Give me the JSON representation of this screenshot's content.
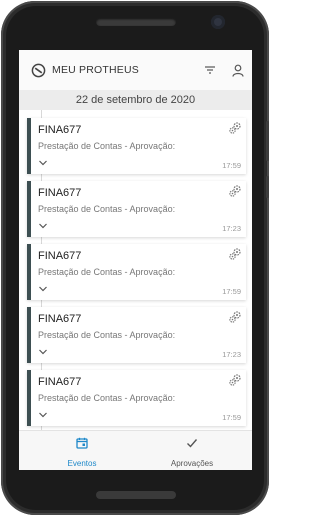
{
  "app": {
    "title": "MEU PROTHEUS"
  },
  "date_header": "22 de setembro de 2020",
  "events": [
    {
      "title": "FINA677",
      "subtitle": "Prestação de Contas - Aprovação:",
      "time": "17:59"
    },
    {
      "title": "FINA677",
      "subtitle": "Prestação de Contas - Aprovação:",
      "time": "17:23"
    },
    {
      "title": "FINA677",
      "subtitle": "Prestação de Contas - Aprovação:",
      "time": "17:59"
    },
    {
      "title": "FINA677",
      "subtitle": "Prestação de Contas - Aprovação:",
      "time": "17:23"
    },
    {
      "title": "FINA677",
      "subtitle": "Prestação de Contas - Aprovação:",
      "time": "17:59"
    }
  ],
  "bottom_nav": {
    "eventos_label": "Eventos",
    "aprovacoes_label": "Aprovações"
  },
  "colors": {
    "accent": "#1e88c9",
    "card_bar": "#3d4f52"
  }
}
